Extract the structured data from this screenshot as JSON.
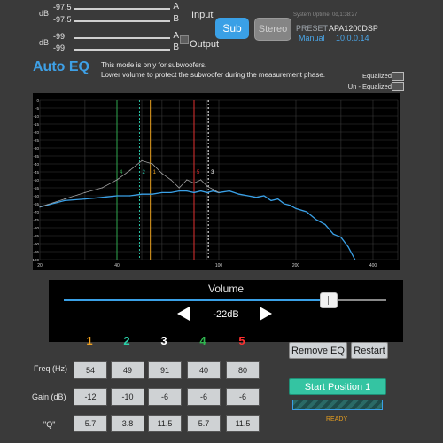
{
  "levels": {
    "input": {
      "label": "Input",
      "unit": "dB",
      "A": "-97.5",
      "B": "-97.5"
    },
    "output": {
      "label": "Output",
      "unit": "dB",
      "A": "-99",
      "B": "-99"
    },
    "channel_a": "A",
    "channel_b": "B"
  },
  "mode_buttons": {
    "sub": "Sub",
    "stereo": "Stereo",
    "active": "Sub"
  },
  "system": {
    "uptime": "System Uptime: 0d,1:38:27",
    "preset_label": "PRESET",
    "preset_name": "APA1200DSP",
    "mode": "Manual",
    "ip": "10.0.0.14"
  },
  "autoeq": {
    "title": "Auto EQ",
    "desc_line1": "This mode is only for subwoofers.",
    "desc_line2": "Lower volume to protect the subwoofer during the measurement phase.",
    "legend_equalized": "Equalized",
    "legend_unequalized": "Un - Equalized"
  },
  "chart_data": {
    "type": "line",
    "x_scale": "log",
    "xlim": [
      20,
      500
    ],
    "ylim": [
      -100,
      0
    ],
    "x_ticks": [
      "20",
      "40",
      "100",
      "200",
      "400"
    ],
    "y_ticks": [
      "0",
      "-5",
      "-10",
      "-15",
      "-20",
      "-25",
      "-30",
      "-35",
      "-40",
      "-45",
      "-50",
      "-55",
      "-60",
      "-65",
      "-70",
      "-75",
      "-80",
      "-85",
      "-90",
      "-95",
      "-100"
    ],
    "grid": true,
    "series": [
      {
        "name": "Equalized",
        "color": "#3aa0e6",
        "x": [
          20,
          25,
          30,
          35,
          40,
          45,
          50,
          55,
          60,
          65,
          70,
          75,
          80,
          85,
          90,
          95,
          100,
          110,
          120,
          130,
          140,
          150,
          160,
          170,
          180,
          190,
          200,
          220,
          240,
          260,
          280,
          300,
          320,
          340
        ],
        "y": [
          -67,
          -63,
          -62,
          -61,
          -60,
          -60,
          -59,
          -59,
          -58,
          -58,
          -57,
          -57,
          -58,
          -57,
          -58,
          -57,
          -58,
          -57,
          -59,
          -60,
          -61,
          -60,
          -63,
          -62,
          -65,
          -66,
          -68,
          -70,
          -75,
          -78,
          -84,
          -86,
          -92,
          -100
        ]
      },
      {
        "name": "Un - Equalized",
        "color": "#a0a0a0",
        "x": [
          20,
          25,
          30,
          35,
          40,
          45,
          50,
          55,
          60,
          65,
          70,
          75,
          80,
          85,
          90,
          95,
          100
        ],
        "y": [
          -67,
          -62,
          -58,
          -55,
          -50,
          -44,
          -38,
          -40,
          -46,
          -50,
          -55,
          -50,
          -52,
          -50,
          -54,
          -56,
          -58
        ]
      }
    ],
    "eq_markers": [
      {
        "band": "1",
        "freq": 54,
        "color": "#e8a020"
      },
      {
        "band": "2",
        "freq": 49,
        "color": "#29c4a6"
      },
      {
        "band": "3",
        "freq": 91,
        "color": "#ffffff"
      },
      {
        "band": "4",
        "freq": 40,
        "color": "#2fa84f"
      },
      {
        "band": "5",
        "freq": 80,
        "color": "#e03030"
      }
    ]
  },
  "volume": {
    "title": "Volume",
    "value": "-22dB",
    "level": 0.82
  },
  "bands": {
    "numbers": [
      {
        "label": "1",
        "color": "#f0a020"
      },
      {
        "label": "2",
        "color": "#29d0a8"
      },
      {
        "label": "3",
        "color": "#ffffff"
      },
      {
        "label": "4",
        "color": "#2fb54f"
      },
      {
        "label": "5",
        "color": "#ff3030"
      }
    ],
    "freq_label": "Freq (Hz)",
    "gain_label": "Gain (dB)",
    "q_label": "\"Q\"",
    "freq": [
      "54",
      "49",
      "91",
      "40",
      "80"
    ],
    "gain": [
      "-12",
      "-10",
      "-6",
      "-6",
      "-6"
    ],
    "q": [
      "5.7",
      "3.8",
      "11.5",
      "5.7",
      "11.5"
    ]
  },
  "actions": {
    "remove_eq": "Remove EQ",
    "restart": "Restart",
    "start_position": "Start Position 1",
    "status": "READY"
  }
}
